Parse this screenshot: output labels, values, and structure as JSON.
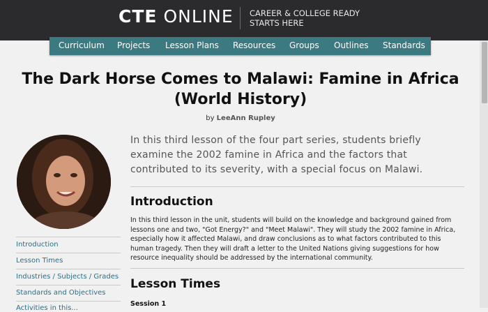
{
  "header": {
    "logo_bold": "CTE",
    "logo_light": "ONLINE",
    "tagline_line1": "CAREER & COLLEGE READY",
    "tagline_line2": "STARTS HERE"
  },
  "nav": {
    "items": [
      "Curriculum",
      "Projects",
      "Lesson Plans",
      "Resources",
      "Groups",
      "Outlines",
      "Standards"
    ]
  },
  "page": {
    "title_line1": "The Dark Horse Comes to Malawi: Famine in Africa",
    "title_line2": "(World History)",
    "by": "by",
    "author": "LeeAnn Rupley",
    "summary": "In this third lesson of the four part series, students briefly examine the 2002 famine in Africa and the factors that contributed to its severity, with a special focus on Malawi.",
    "intro_heading": "Introduction",
    "intro_text": "In this third lesson in the unit, students will build on the knowledge and background gained from lessons one and two, \"Got Energy?\" and \"Meet Malawi\". They will study the 2002 famine in Africa, especially how it affected Malawi, and draw conclusions as to what factors contributed to this human tragedy. Then they will draft a letter to the United Nations giving suggestions for how resource inequality should be addressed by the international community.",
    "times_heading": "Lesson Times",
    "session": "Session 1"
  },
  "sidebar": {
    "items": [
      "Introduction",
      "Lesson Times",
      "Industries / Subjects / Grades",
      "Standards and Objectives",
      "Activities in this..."
    ]
  },
  "colors": {
    "topbar": "#2b2a2c",
    "nav": "#3c7a82",
    "link": "#2c6f86"
  }
}
